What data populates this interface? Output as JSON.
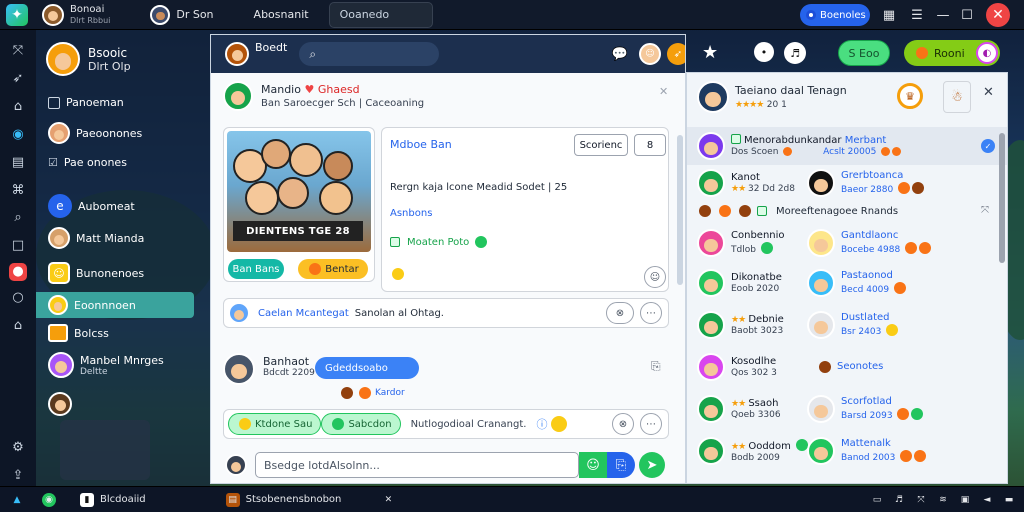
{
  "topbar": {
    "user_name": "Bonoai",
    "user_sub": "Dlrt Rbbui",
    "tab_label": "Dr Son",
    "tab2_label": "Abosnanit",
    "search_value": "Ooanedo",
    "status_button": "Boenoles"
  },
  "rail": {
    "icons": [
      "share-icon",
      "rocket-icon",
      "home-icon",
      "globe-icon",
      "grid-icon",
      "gamepad-icon",
      "search-icon",
      "square-icon",
      "record-icon",
      "circle-icon",
      "bookmark-icon",
      "settings-icon",
      "upload-icon"
    ]
  },
  "sidebar": {
    "header_title": "Bsooic",
    "header_sub": "Dlrt Olp",
    "items": [
      {
        "label": "Panoeman"
      },
      {
        "label": "Paeoonones"
      },
      {
        "label": "Pae onones"
      },
      {
        "label": "Aubomeat"
      },
      {
        "label": "Matt Mianda"
      },
      {
        "label": "Bunonenoes"
      },
      {
        "label": "Eoonnnoen"
      },
      {
        "label": "Bolcss"
      },
      {
        "label": "Manbel Mnrges",
        "sub": "Deltte"
      },
      {
        "label": ""
      }
    ]
  },
  "chat": {
    "channel_name": "Boedt",
    "post_author": "Mandio",
    "post_tag": "Ghaesd",
    "post_sub": "Ban Saroecger Sch | Caceoaning",
    "art_banner": "DIENTENS TGE 28",
    "art_chip": "Ban Bans",
    "art_chip2": "Bentar",
    "card_link": "Mdboe Ban",
    "card_action": "Scorienc",
    "card_count": "8",
    "card_text": "Rergn kaja lcone Meadid Sodet | 25",
    "card_sub_link": "Asnbons",
    "card_tag": "Moaten Poto",
    "reply_link": "Caelan Mcantegat",
    "reply_text": "Sanolan al Ohtag.",
    "msg_author": "Banhaot",
    "msg_time": "Bdcdt 2209",
    "msg_bubble": "Gdeddsoabo",
    "msg_bubble_sub": "Kardor",
    "reaction_left": "Ktdone Sau",
    "reaction_mid": "Sabcdon",
    "reaction_text": "Nutlogodioal Cranangt.",
    "input_placeholder": "Bsedge lotdAlsolnn..."
  },
  "right": {
    "btn_green": "S Eoo",
    "btn_orange": "Rooni"
  },
  "friends": {
    "title": "Taeiano daal Tenagn",
    "title_stars": "★★★★",
    "title_num": "20 1",
    "featured": {
      "name": "Menorabdunkandar",
      "extra": "Merbant",
      "sub": "Dos Scoen",
      "sub_link": "Acslt 20005"
    },
    "group_text": "Moreeftenagoee Rnands",
    "rows": [
      {
        "name": "Kanot",
        "sub": "32 Dd 2d8",
        "name2": "Grerbtoanca",
        "sub2": "Baeor 2880"
      },
      {
        "name": "Conbennio",
        "sub": "Tdlob",
        "name2": "Gantdlaonc",
        "sub2": "Bocebe 4988"
      },
      {
        "name": "Dikonatbe",
        "sub": "Eoob 2020",
        "name2": "Pastaonod",
        "sub2": "Becd 4009"
      },
      {
        "name": "Debnie",
        "sub": "Baobt 3023",
        "name2": "Dustlated",
        "sub2": "Bsr 2403"
      },
      {
        "name": "Kosodlhe",
        "sub": "Qos 302 3",
        "name2": "Seonotes",
        "sub2": ""
      },
      {
        "name": "Ssaoh",
        "sub": "Qoeb 3306",
        "name2": "Scorfotlad",
        "sub2": "Barsd 2093"
      },
      {
        "name": "Ooddom",
        "sub": "Bodb 2009",
        "name2": "Mattenalk",
        "sub2": "Banod 2003"
      }
    ]
  },
  "taskbar": {
    "item1": "Blcdoaiid",
    "item2": "Stsobenensbnobon",
    "clock": ""
  },
  "colors": {
    "accent": "#3aa39d",
    "primary": "#2563eb",
    "danger": "#ef4444",
    "green": "#22c55e",
    "dark": "#111a2b"
  }
}
